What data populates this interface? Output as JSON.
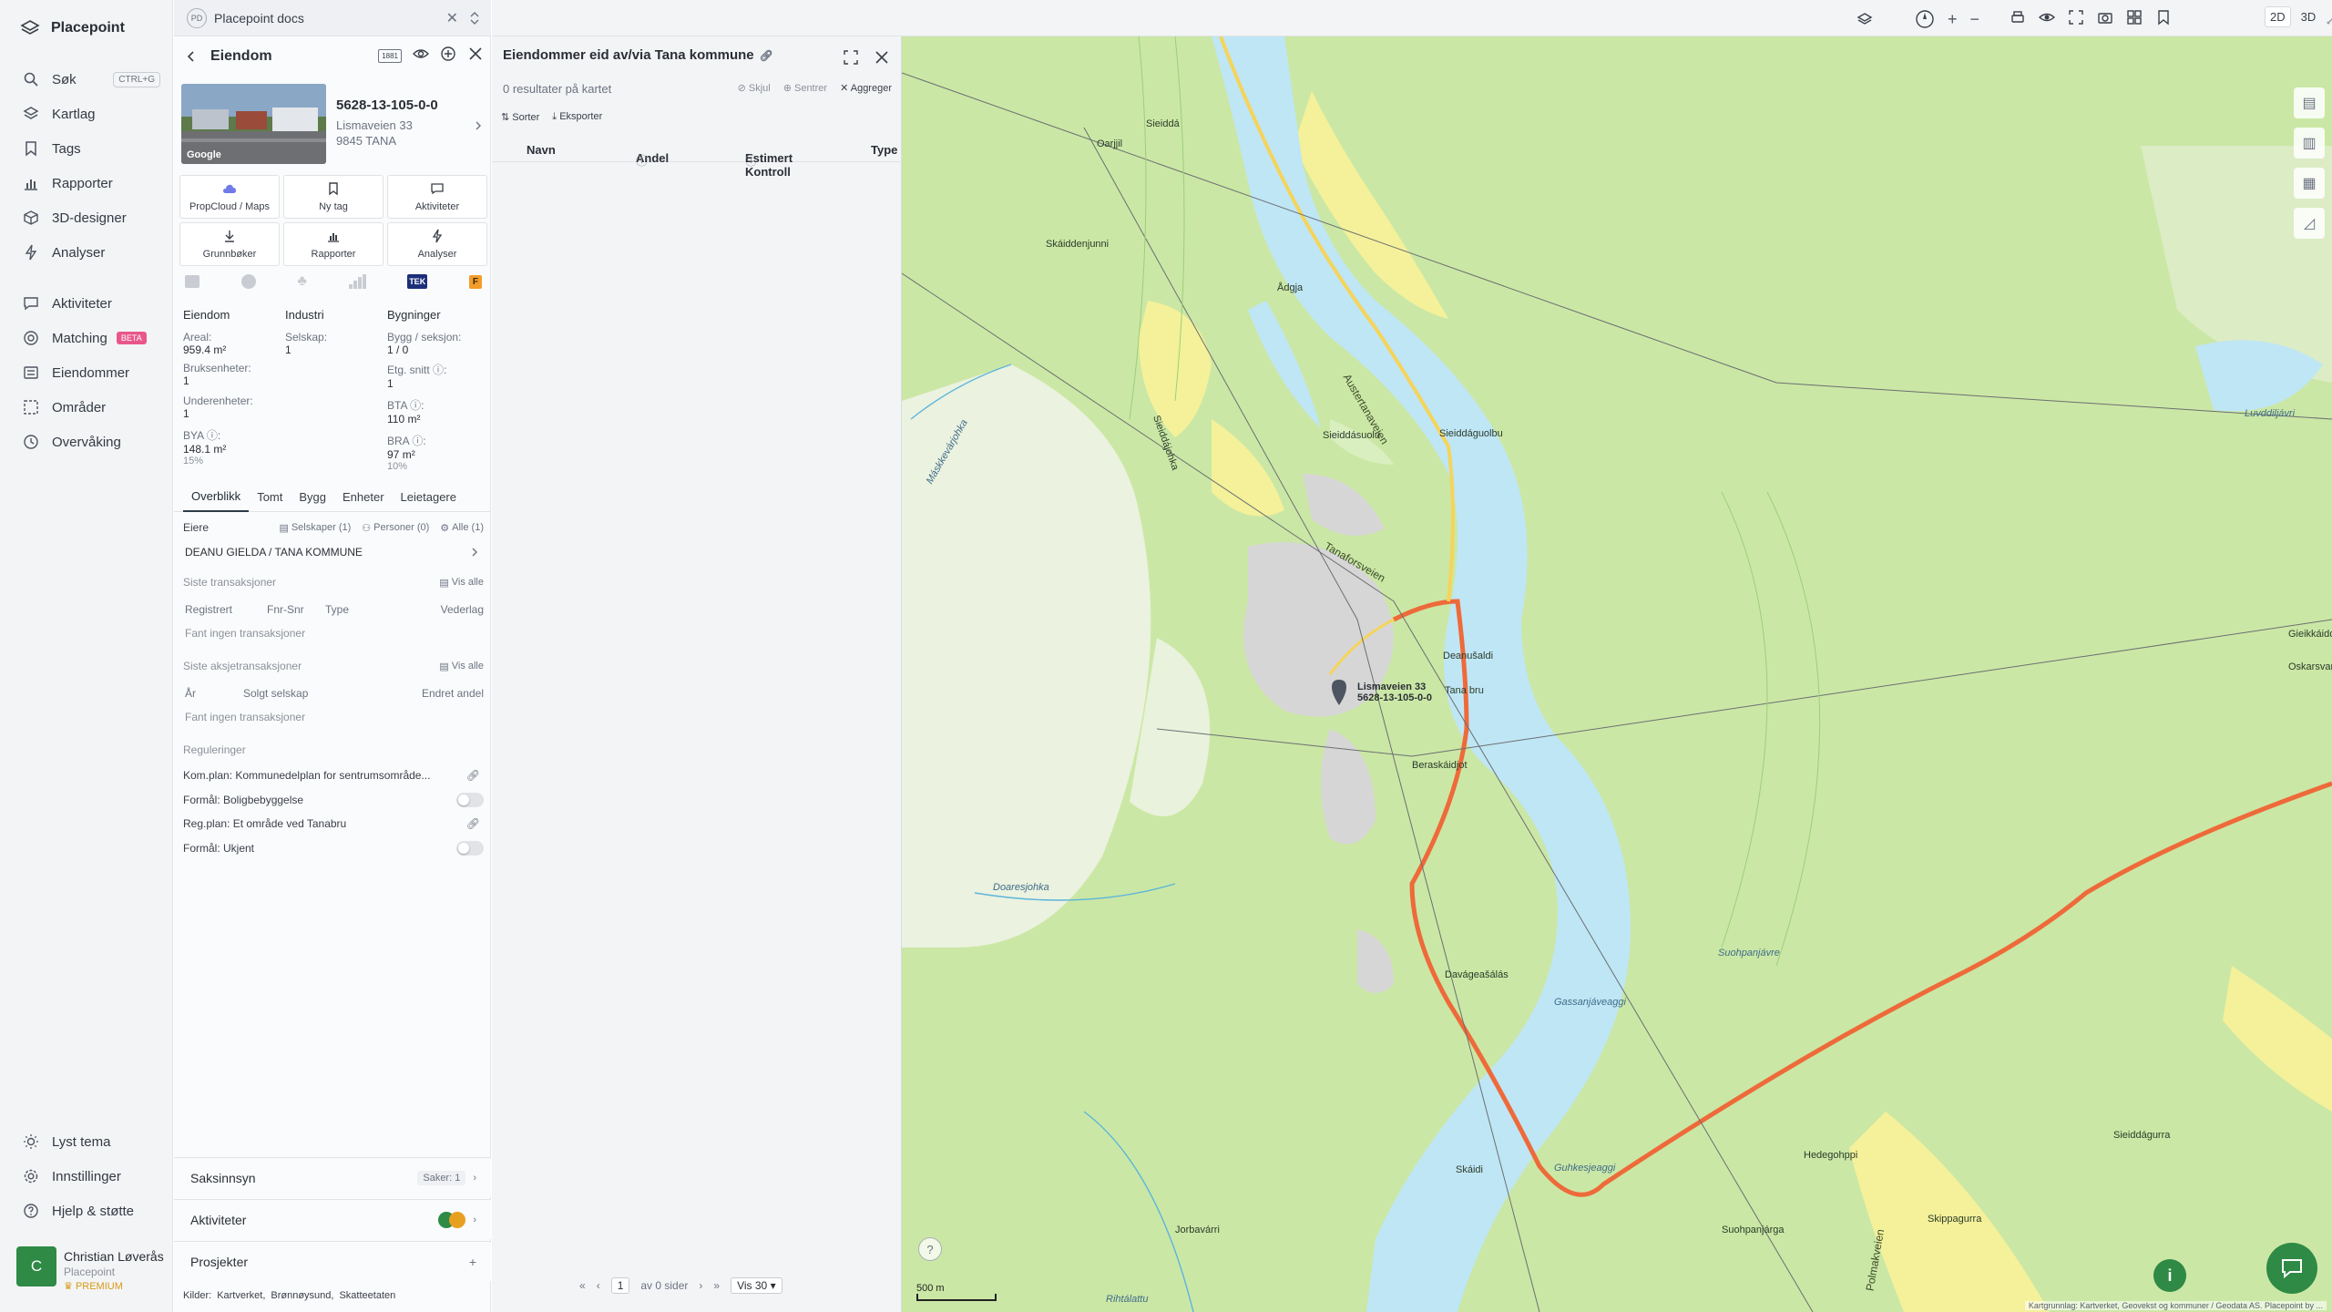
{
  "app": {
    "name": "Placepoint"
  },
  "sidebar": {
    "items": [
      {
        "label": "Søk",
        "icon": "search-icon",
        "shortcut": "CTRL+G"
      },
      {
        "label": "Kartlag",
        "icon": "layers-icon"
      },
      {
        "label": "Tags",
        "icon": "bookmark-icon"
      },
      {
        "label": "Rapporter",
        "icon": "chart-icon"
      },
      {
        "label": "3D-designer",
        "icon": "cube-icon"
      },
      {
        "label": "Analyser",
        "icon": "bolt-icon"
      },
      {
        "label": "Aktiviteter",
        "icon": "chat-icon"
      },
      {
        "label": "Matching",
        "icon": "target-icon",
        "badge": "BETA"
      },
      {
        "label": "Eiendommer",
        "icon": "list-icon"
      },
      {
        "label": "Områder",
        "icon": "area-icon"
      },
      {
        "label": "Overvåking",
        "icon": "eye-icon"
      }
    ],
    "bottom_items": [
      {
        "label": "Lyst tema",
        "icon": "sun-icon"
      },
      {
        "label": "Innstillinger",
        "icon": "gear-icon"
      },
      {
        "label": "Hjelp & støtte",
        "icon": "help-icon"
      }
    ],
    "user": {
      "initial": "C",
      "name": "Christian Løverås",
      "org": "Placepoint",
      "plan": "PREMIUM"
    }
  },
  "workspace": {
    "badge": "PD",
    "title": "Placepoint docs"
  },
  "property": {
    "panel_title": "Eiendom",
    "id": "5628-13-105-0-0",
    "address": "Lismaveien 33",
    "postal": "9845 TANA",
    "photo_credit": "Google",
    "header_badge": "1881",
    "actions": [
      {
        "label": "PropCloud / Maps",
        "icon": "cloud-icon"
      },
      {
        "label": "Ny tag",
        "icon": "bookmark-icon"
      },
      {
        "label": "Aktiviteter",
        "icon": "chat-icon"
      },
      {
        "label": "Grunnbøker",
        "icon": "download-icon"
      },
      {
        "label": "Rapporter",
        "icon": "chart-icon"
      },
      {
        "label": "Analyser",
        "icon": "bolt-icon"
      }
    ],
    "source_logos": [
      "TEK",
      "F"
    ],
    "stats": {
      "col1_title": "Eiendom",
      "col2_title": "Industri",
      "col3_title": "Bygninger",
      "areal_label": "Areal:",
      "areal_value": "959.4",
      "bruksenheter_label": "Bruksenheter:",
      "bruksenheter_value": "1",
      "underenheter_label": "Underenheter:",
      "underenheter_value": "1",
      "bya_label": "BYA",
      "bya_value": "148.1",
      "bya_pct": "15%",
      "selskap_label": "Selskap:",
      "selskap_value": "1",
      "bygg_label": "Bygg / seksjon:",
      "bygg_value": "1 / 0",
      "etg_label": "Etg. snitt",
      "etg_value": "1",
      "bta_label": "BTA",
      "bta_value": "110",
      "bra_label": "BRA",
      "bra_value": "97",
      "bra_pct": "10%",
      "unit": "m²"
    },
    "tabs": [
      "Overblikk",
      "Tomt",
      "Bygg",
      "Enheter",
      "Leietagere"
    ],
    "owners": {
      "label": "Eiere",
      "filter_companies": "Selskaper (1)",
      "filter_persons": "Personer (0)",
      "filter_all": "Alle (1)",
      "owner_name": "DEANU GIELDA / TANA KOMMUNE"
    },
    "transactions": {
      "title": "Siste transaksjoner",
      "show_all": "Vis alle",
      "cols": [
        "Registrert",
        "Fnr-Snr",
        "Type",
        "Vederlag"
      ],
      "empty": "Fant ingen transaksjoner"
    },
    "share_transactions": {
      "title": "Siste aksjetransaksjoner",
      "show_all": "Vis alle",
      "cols": [
        "År",
        "Solgt selskap",
        "Endret andel"
      ],
      "empty": "Fant ingen transaksjoner"
    },
    "regulations": {
      "title": "Reguleringer",
      "items": [
        {
          "text": "Kom.plan: Kommunedelplan for sentrumsområde...",
          "kind": "link"
        },
        {
          "text": "Formål: Boligbebyggelse",
          "kind": "toggle"
        },
        {
          "text": "Reg.plan: Et område ved Tanabru",
          "kind": "link"
        },
        {
          "text": "Formål: Ukjent",
          "kind": "toggle"
        }
      ]
    },
    "bottom": {
      "saksinnsyn": "Saksinnsyn",
      "saker": "Saker: 1",
      "aktiviteter": "Aktiviteter",
      "prosjekter": "Prosjekter"
    },
    "sources_label": "Kilder:",
    "sources": [
      "Kartverket,",
      "Brønnøysund,",
      "Skatteetaten"
    ]
  },
  "results": {
    "title": "Eiendommer eid av/via Tana kommune",
    "subtitle": "0 resultater på kartet",
    "hide": "Skjul",
    "center": "Sentrer",
    "aggregate": "Aggreger",
    "sort": "Sorter",
    "export": "Eksporter",
    "columns": [
      "Navn",
      "Andel",
      "Estimert Kontroll",
      "Type"
    ],
    "pager": {
      "page": "1",
      "of_text": "av 0 sider",
      "per_page": "Vis 30"
    }
  },
  "map": {
    "modes": [
      "2D",
      "3D"
    ],
    "active_mode": "2D",
    "scale_label": "500 m",
    "attribution": "Kartgrunnlag: Kartverket, Geovekst og kommuner / Geodata AS. Placepoint by ...",
    "marker_address": "Lismaveien 33",
    "marker_id": "5628-13-105-0-0",
    "places": [
      "Sieiddá",
      "Oarjjil",
      "Skáiddenjunni",
      "Ådgja",
      "Austertanaveien",
      "Sieiddásuolu",
      "Máskkevárjohka",
      "Sieiddájohka",
      "Deanušaldi",
      "Tana bru",
      "Beraskáidjot",
      "Doaresjohka",
      "Davágeašálás",
      "Gassanjáveaggi",
      "Suohpanjávre",
      "Gieikkáidos",
      "Oskarsvar",
      "Skáidi",
      "Jorbavárri",
      "Rihtálattu",
      "Hedegohppi",
      "Skippagurra",
      "Polmakveien",
      "Guhkesjeaggi",
      "Suohpanjárga",
      "Tanaforsveien",
      "Luvddiljávri",
      "Sieiddáguolbu",
      "Sieiddágurra"
    ],
    "colors": {
      "forest": "#cbe7a5",
      "river": "#bfe6f5",
      "settlement": "#d6d6d6",
      "road_main": "#ee6a3a",
      "road_secondary": "#f5d45a",
      "farmland": "#f4f19a"
    }
  }
}
